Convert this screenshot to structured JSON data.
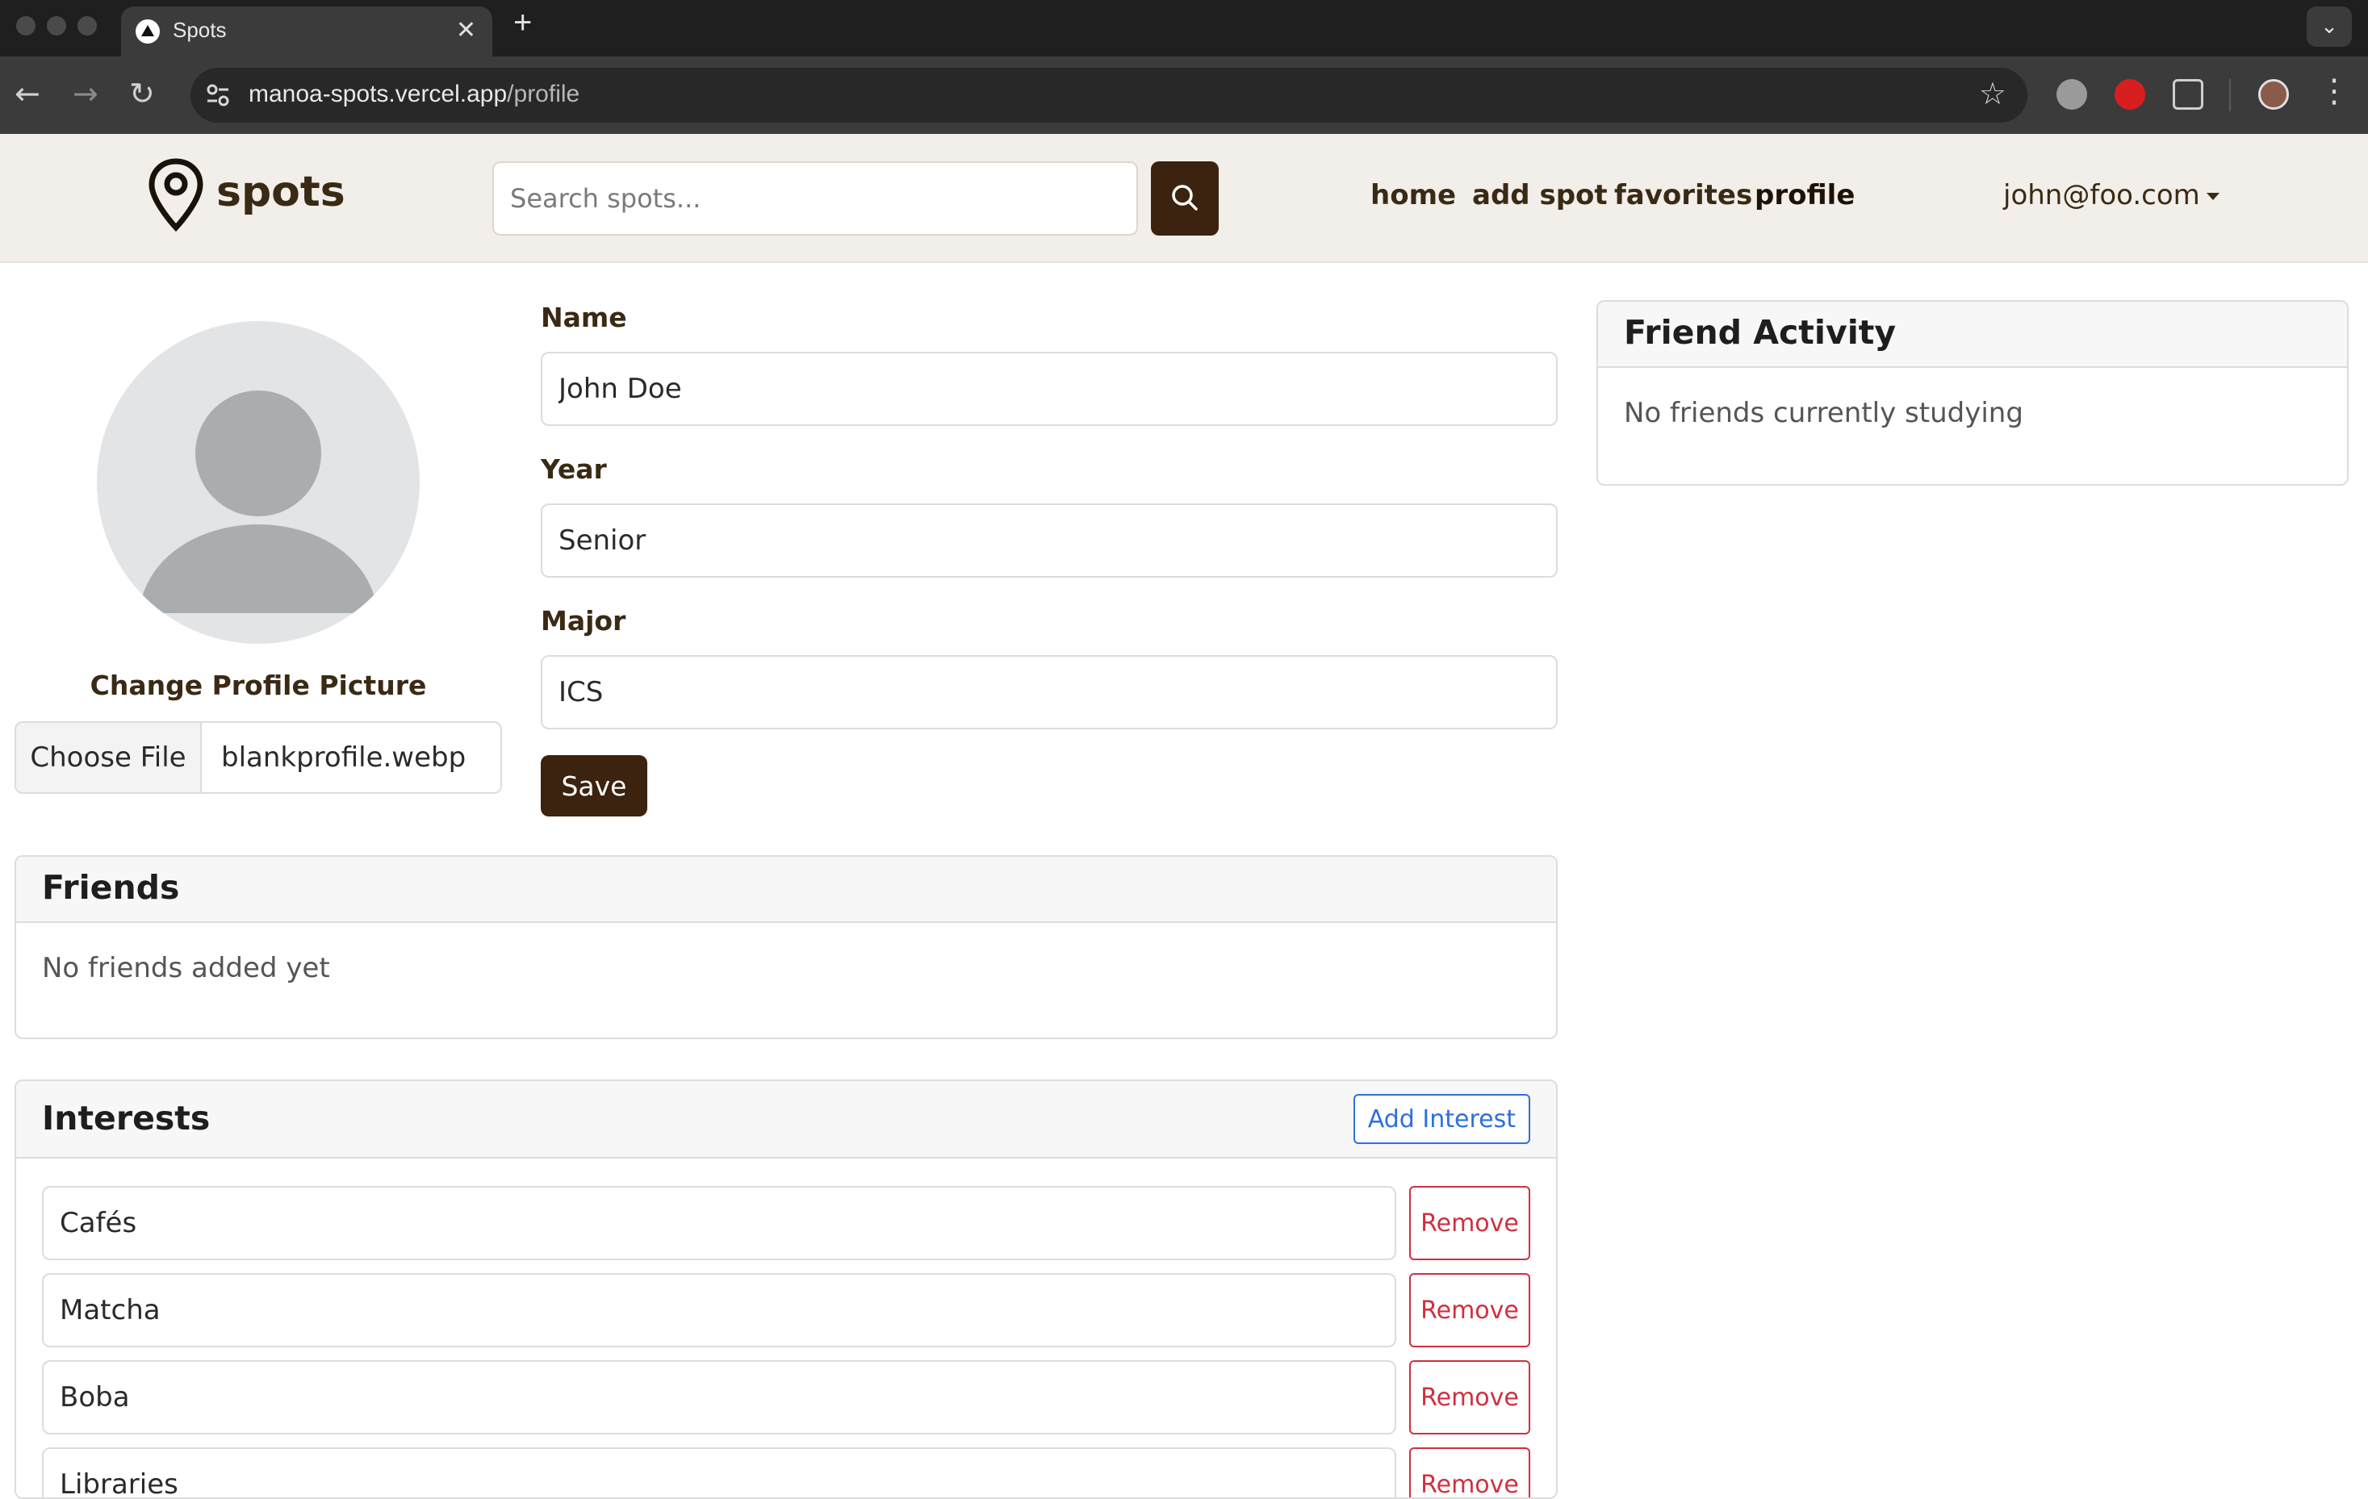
{
  "browser": {
    "tab_title": "Spots",
    "tab_close": "✕",
    "new_tab": "+",
    "url_host": "manoa-spots.vercel.app",
    "url_path": "/profile",
    "icons": [
      "back-icon",
      "forward-icon",
      "reload-icon",
      "site-settings-icon",
      "bookmark-star-icon",
      "extensions-icon",
      "profile-icon",
      "menu-icon"
    ]
  },
  "site": {
    "brand": "spots",
    "search_placeholder": "Search spots...",
    "nav": {
      "home": "home",
      "add_spot": "add spot",
      "favorites": "favorites",
      "profile": "profile"
    },
    "user_email": "john@foo.com",
    "colors": {
      "brand_dark": "#3b230f",
      "nav_bg": "#f2efea",
      "link_blue": "#2f6fdd",
      "danger": "#d03040"
    }
  },
  "profile": {
    "change_picture_label": "Change Profile Picture",
    "file_button": "Choose File",
    "file_name": "blankprofile.webp",
    "form": {
      "name_label": "Name",
      "name_value": "John Doe",
      "year_label": "Year",
      "year_value": "Senior",
      "major_label": "Major",
      "major_value": "ICS",
      "save_label": "Save"
    }
  },
  "friends": {
    "title": "Friends",
    "empty_text": "No friends added yet"
  },
  "interests": {
    "title": "Interests",
    "add_label": "Add Interest",
    "remove_label": "Remove",
    "items": [
      "Cafés",
      "Matcha",
      "Boba",
      "Libraries"
    ]
  },
  "friend_activity": {
    "title": "Friend Activity",
    "empty_text": "No friends currently studying"
  }
}
